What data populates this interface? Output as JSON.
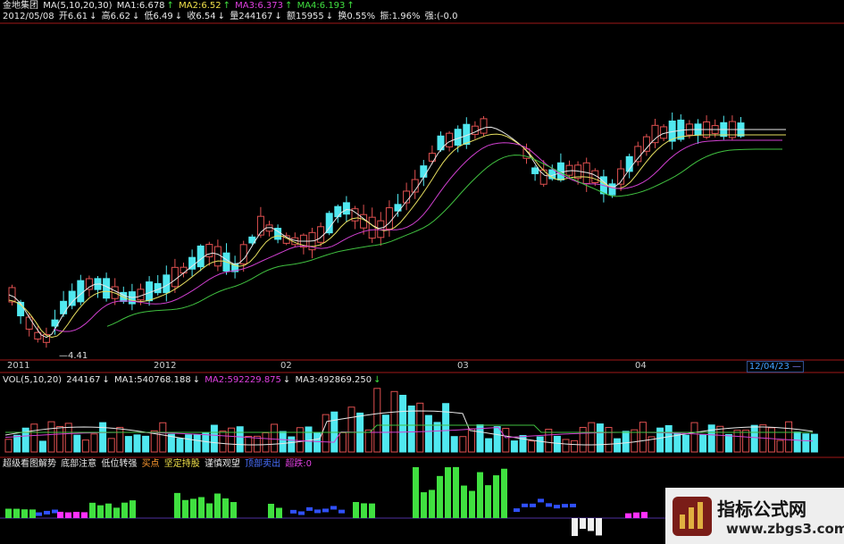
{
  "quote_header": {
    "stock_name": "金地集团",
    "ma_setting": "MA(5,10,20,30)",
    "ma1": "MA1:6.678",
    "ma2": "MA2:6.52",
    "ma3": "MA3:6.373",
    "ma4": "MA4:6.193",
    "date": "2012/05/08",
    "open": "开6.61",
    "high": "高6.62",
    "low": "低6.49",
    "close": "收6.54",
    "volume": "量244167",
    "amount": "额15955",
    "turnover": "换0.55%",
    "amplitude": "振:1.96%",
    "strength": "强:(-0.0"
  },
  "price_chart": {
    "low_marker": "4.41"
  },
  "date_axis": {
    "labels": [
      "2011",
      "2012",
      "02",
      "03",
      "04"
    ],
    "cursor_date": "12/04/23"
  },
  "volume_header": {
    "setting": "VOL(5,10,20)",
    "vol": "244167",
    "ma1": "MA1:540768.188",
    "ma2": "MA2:592229.875",
    "ma3": "MA3:492869.250"
  },
  "indicator_header": {
    "name": "超级看图解势",
    "bottom_attention": "底部注意",
    "low_strengthen": "低位转强",
    "buy_point": "买点",
    "hold_firmly": "坚定持股",
    "cautious_watch": "谨慎观望",
    "top_sell": "顶部卖出",
    "super_drop": "超跌:0"
  },
  "watermark": {
    "title": "指标公式网",
    "url": "www.zbgs3.com"
  },
  "colors": {
    "up": "#e05050",
    "down": "#50e8f0",
    "ma1": "#e8e8e8",
    "ma2": "#e8e060",
    "ma3": "#d040d0",
    "ma4": "#40c040",
    "ind_green": "#40e040",
    "ind_magenta": "#ff30ff",
    "ind_blue": "#3050ff"
  }
}
